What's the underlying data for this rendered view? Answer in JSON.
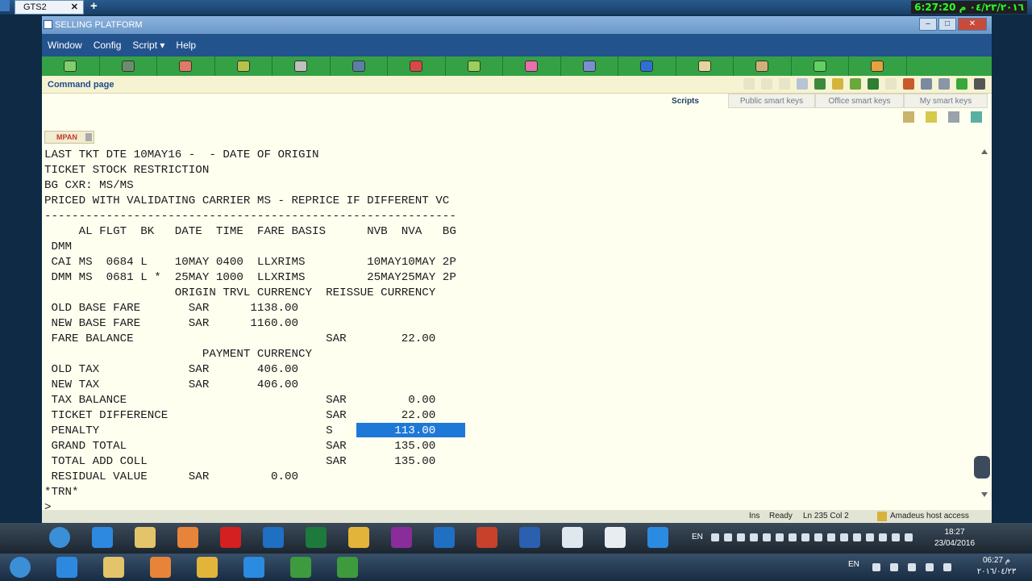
{
  "remote": {
    "tab_label": "GTS2",
    "tab_close": "✕",
    "new_tab": "+",
    "clock": "6:27:20 ٠٤/٢٣/٢٠١٦ م"
  },
  "window": {
    "title": "SELLING PLATFORM",
    "controls": [
      "–",
      "□",
      "✕"
    ]
  },
  "menu": {
    "items": [
      "Window",
      "Config",
      "Script ▾",
      "Help"
    ]
  },
  "toolbar": {
    "icons": [
      "book-icon",
      "terminal-icon",
      "person-icon",
      "money-icon",
      "bug-icon",
      "car-icon",
      "agent-icon",
      "map-icon",
      "ticket-icon",
      "document-icon",
      "info-icon",
      "magnifier-icon",
      "users-icon",
      "cart-icon",
      "pencil-icon"
    ],
    "colors": [
      "#7fcf6b",
      "#6d8c6d",
      "#e07a68",
      "#b7c24a",
      "#c0c0c0",
      "#5d7ea8",
      "#d94848",
      "#9bcf5b",
      "#e96fae",
      "#7b8fd0",
      "#2e6fd6",
      "#e5d4a0",
      "#d0b07a",
      "#5fd35f",
      "#e8a13f"
    ]
  },
  "command_page": {
    "title": "Command page",
    "tabs": [
      "Scripts",
      "Public smart keys",
      "Office smart keys",
      "My smart keys"
    ],
    "active_tab": "Scripts"
  },
  "mpan_button": "MPAN",
  "terminal": {
    "lines": [
      "LAST TKT DTE 10MAY16 -  - DATE OF ORIGIN",
      "TICKET STOCK RESTRICTION",
      "BG CXR: MS/MS",
      "PRICED WITH VALIDATING CARRIER MS - REPRICE IF DIFFERENT VC",
      "------------------------------------------------------------",
      "     AL FLGT  BK   DATE  TIME  FARE BASIS      NVB  NVA   BG",
      " DMM",
      " CAI MS  0684 L    10MAY 0400  LLXRIMS         10MAY10MAY 2P",
      " DMM MS  0681 L *  25MAY 1000  LLXRIMS         25MAY25MAY 2P",
      "                   ORIGIN TRVL CURRENCY  REISSUE CURRENCY",
      " OLD BASE FARE       SAR      1138.00",
      " NEW BASE FARE       SAR      1160.00",
      " FARE BALANCE                            SAR        22.00",
      "                       PAYMENT CURRENCY",
      " OLD TAX             SAR       406.00",
      " NEW TAX             SAR       406.00",
      " TAX BALANCE                             SAR         0.00",
      " TICKET DIFFERENCE                       SAR        22.00",
      " PENALTY                                 SAR       113.00",
      " GRAND TOTAL                             SAR       135.00",
      " TOTAL ADD COLL                          SAR       135.00",
      " RESIDUAL VALUE      SAR         0.00",
      "*TRN*",
      ">"
    ],
    "selected_text": "AR       113.00"
  },
  "status": {
    "mode": "Ins",
    "state": "Ready",
    "position": "Ln 235 Col 2",
    "host": "Amadeus host access"
  },
  "inner_taskbar": {
    "lang": "EN",
    "time": "18:27",
    "date": "23/04/2016",
    "apps": [
      "start-orb",
      "internet-explorer-icon",
      "folder-icon",
      "media-icon",
      "opera-icon",
      "outlook-icon",
      "excel-icon",
      "chrome-icon",
      "onenote-icon",
      "outlook-alt-icon",
      "powerpoint-icon",
      "word-icon",
      "ie-active-icon",
      "amadeus-icon",
      "teamviewer-icon"
    ],
    "colors": [
      "#3b8fd6",
      "#2d89e0",
      "#e3c46a",
      "#e8843a",
      "#d42020",
      "#1f6fc2",
      "#1d7a3c",
      "#e2b43a",
      "#8a2d9a",
      "#1f6fc2",
      "#c8412b",
      "#2b5fb0",
      "#dfe7ef",
      "#e8edf2",
      "#2b8be0"
    ]
  },
  "outer_taskbar": {
    "lang": "EN",
    "time": "06:27 م",
    "date": "٢٠١٦/٠٤/٢٣",
    "apps": [
      "start-orb",
      "internet-explorer-icon",
      "folder-icon",
      "media-icon",
      "chrome-icon",
      "teamviewer-icon",
      "camtasia-icon",
      "camtasia-alt-icon"
    ],
    "colors": [
      "#3b8fd6",
      "#2d89e0",
      "#e3c46a",
      "#e8843a",
      "#e2b43a",
      "#2b8be0",
      "#3d9a3d",
      "#3d9a3d"
    ]
  }
}
